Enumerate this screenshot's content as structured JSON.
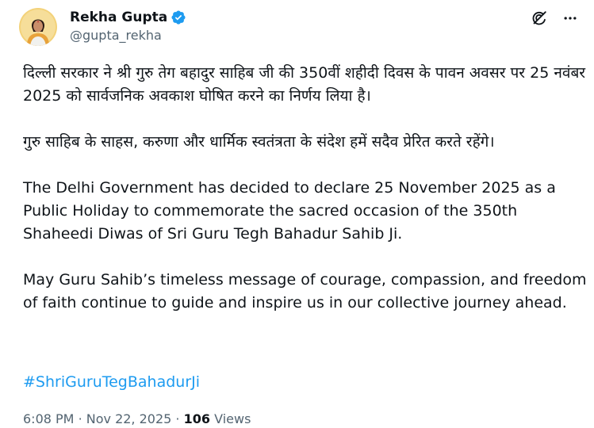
{
  "author": {
    "display_name": "Rekha Gupta",
    "handle": "@gupta_rekha",
    "verified": true
  },
  "icons": {
    "verified": "verified-badge-icon",
    "grok": "grok-icon",
    "more": "more-options-icon"
  },
  "tweet": {
    "hindi_para1": "दिल्ली सरकार ने श्री गुरु तेग बहादुर साहिब जी की 350वीं शहीदी दिवस के पावन अवसर पर 25 नवंबर 2025 को सार्वजनिक अवकाश घोषित करने का निर्णय लिया है।",
    "hindi_para2": "गुरु साहिब के साहस, करुणा और धार्मिक स्वतंत्रता के संदेश हमें सदैव प्रेरित करते रहेंगे।",
    "english_para1": "The Delhi Government has decided to declare 25 November 2025 as a Public Holiday to commemorate the sacred occasion of the 350th Shaheedi Diwas of Sri Guru Tegh Bahadur Sahib Ji.",
    "english_para2": "May Guru Sahib’s timeless message of courage, compassion, and freedom of faith continue to guide and inspire us in our collective journey ahead.",
    "hashtag": "#ShriGuruTegBahadurJi"
  },
  "meta": {
    "time": "6:08 PM",
    "separator": "·",
    "date": "Nov 22, 2025",
    "views_count": "106",
    "views_label": "Views"
  },
  "colors": {
    "text": "#0f1419",
    "secondary": "#536471",
    "link": "#1d9bf0",
    "verified": "#1d9bf0"
  }
}
